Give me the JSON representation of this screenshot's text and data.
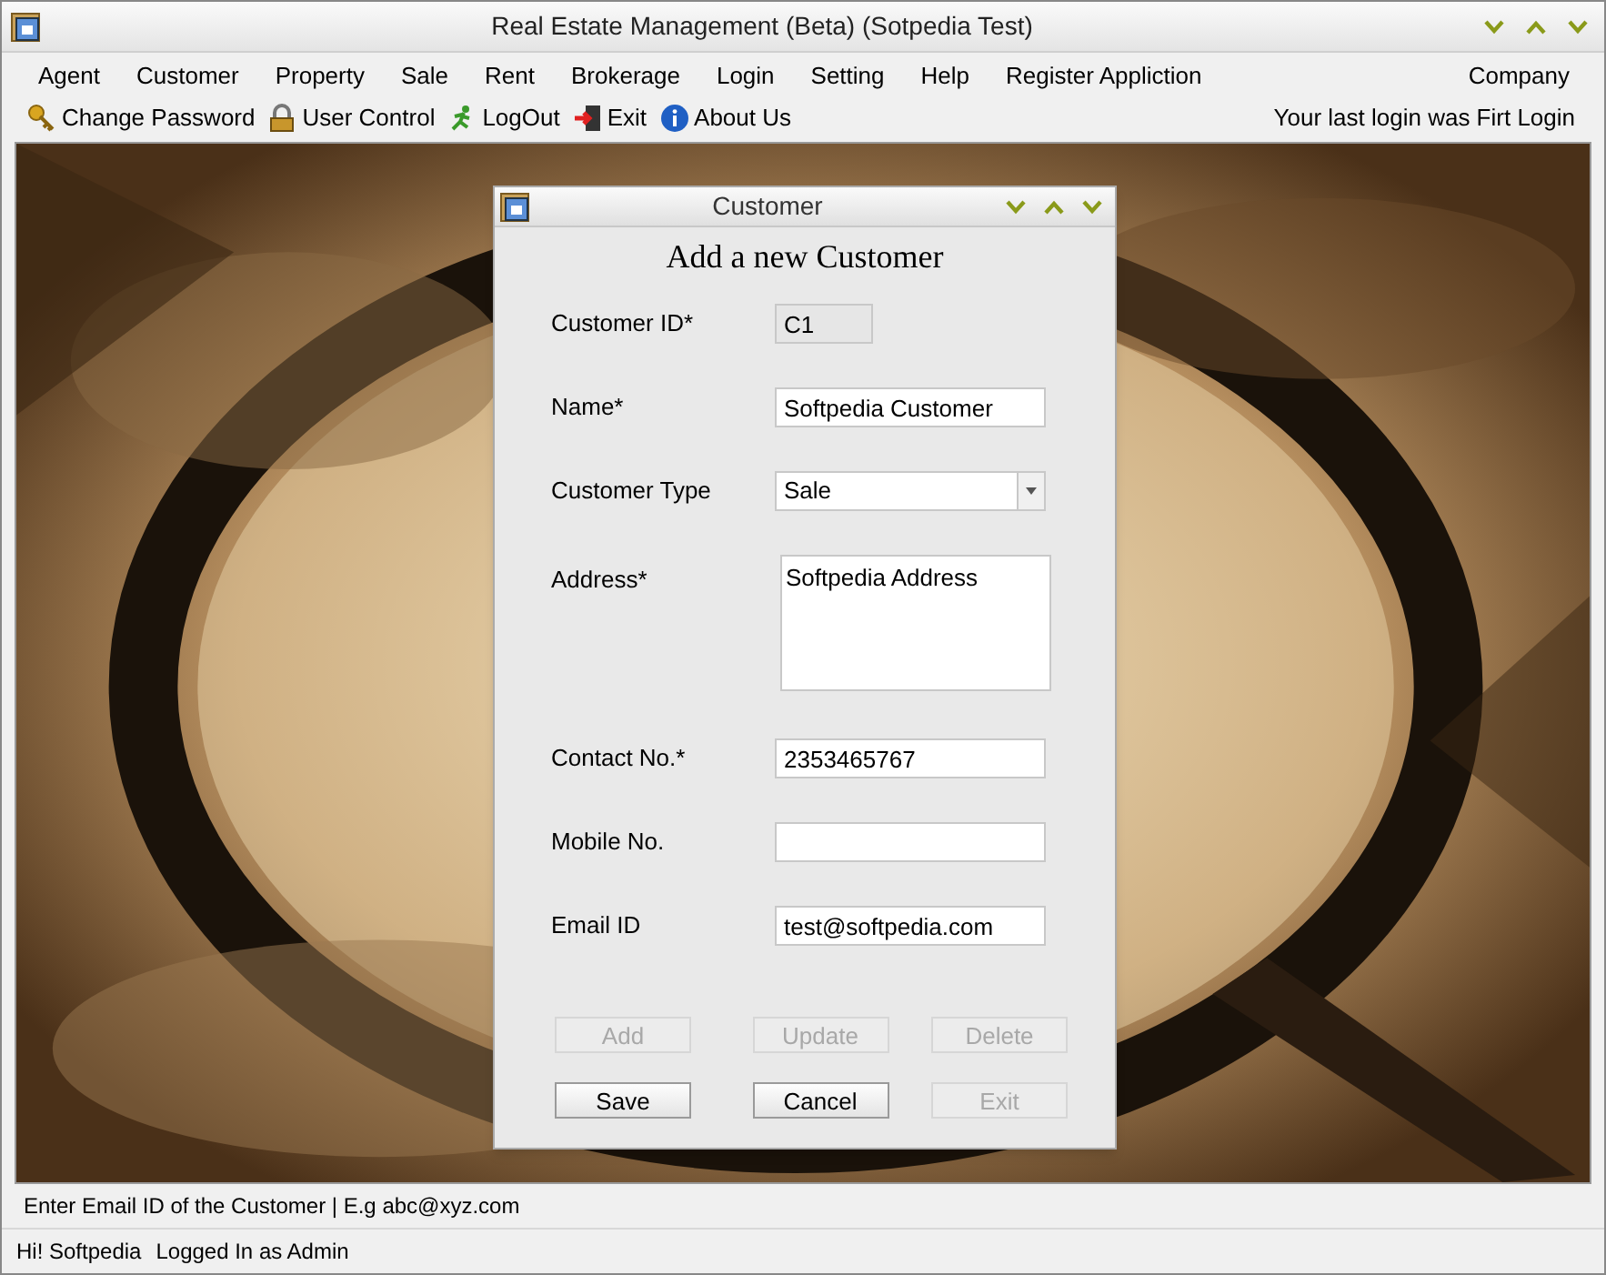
{
  "window": {
    "title": "Real Estate Management (Beta) (Sotpedia Test)"
  },
  "menu": {
    "items": [
      "Agent",
      "Customer",
      "Property",
      "Sale",
      "Rent",
      "Brokerage",
      "Login",
      "Setting",
      "Help",
      "Register Appliction"
    ],
    "right": "Company"
  },
  "toolbar": {
    "items": [
      {
        "label": "Change Password",
        "kind": "key"
      },
      {
        "label": "User Control",
        "kind": "lock"
      },
      {
        "label": "LogOut",
        "kind": "run"
      },
      {
        "label": "Exit",
        "kind": "exit"
      },
      {
        "label": "About Us",
        "kind": "info"
      }
    ],
    "login_note": "Your last login was Firt Login"
  },
  "dialog": {
    "title": "Customer",
    "heading": "Add a new Customer",
    "fields": [
      {
        "label": "Customer ID*",
        "kind": "readonly",
        "value": "C1"
      },
      {
        "label": "Name*",
        "kind": "text",
        "value": "Softpedia Customer"
      },
      {
        "label": "Customer Type",
        "kind": "combo",
        "value": "Sale"
      },
      {
        "label": "Address*",
        "kind": "textarea",
        "value": "Softpedia Address"
      },
      {
        "label": "Contact No.*",
        "kind": "text",
        "value": "2353465767"
      },
      {
        "label": "Mobile No.",
        "kind": "text"
      },
      {
        "label": "Email ID",
        "kind": "text",
        "value": "test@softpedia.com"
      }
    ],
    "buttons": [
      {
        "label": "Add",
        "disabled": true
      },
      {
        "label": "Update",
        "disabled": true
      },
      {
        "label": "Delete",
        "disabled": true
      },
      {
        "label": "Save",
        "disabled": false
      },
      {
        "label": "Cancel",
        "disabled": false
      },
      {
        "label": "Exit",
        "disabled": true
      }
    ]
  },
  "status_bar": {
    "hint": "Enter Email ID of the Customer | E.g abc@xyz.com",
    "user": "Hi! Softpedia",
    "role": "Logged In as Admin"
  }
}
